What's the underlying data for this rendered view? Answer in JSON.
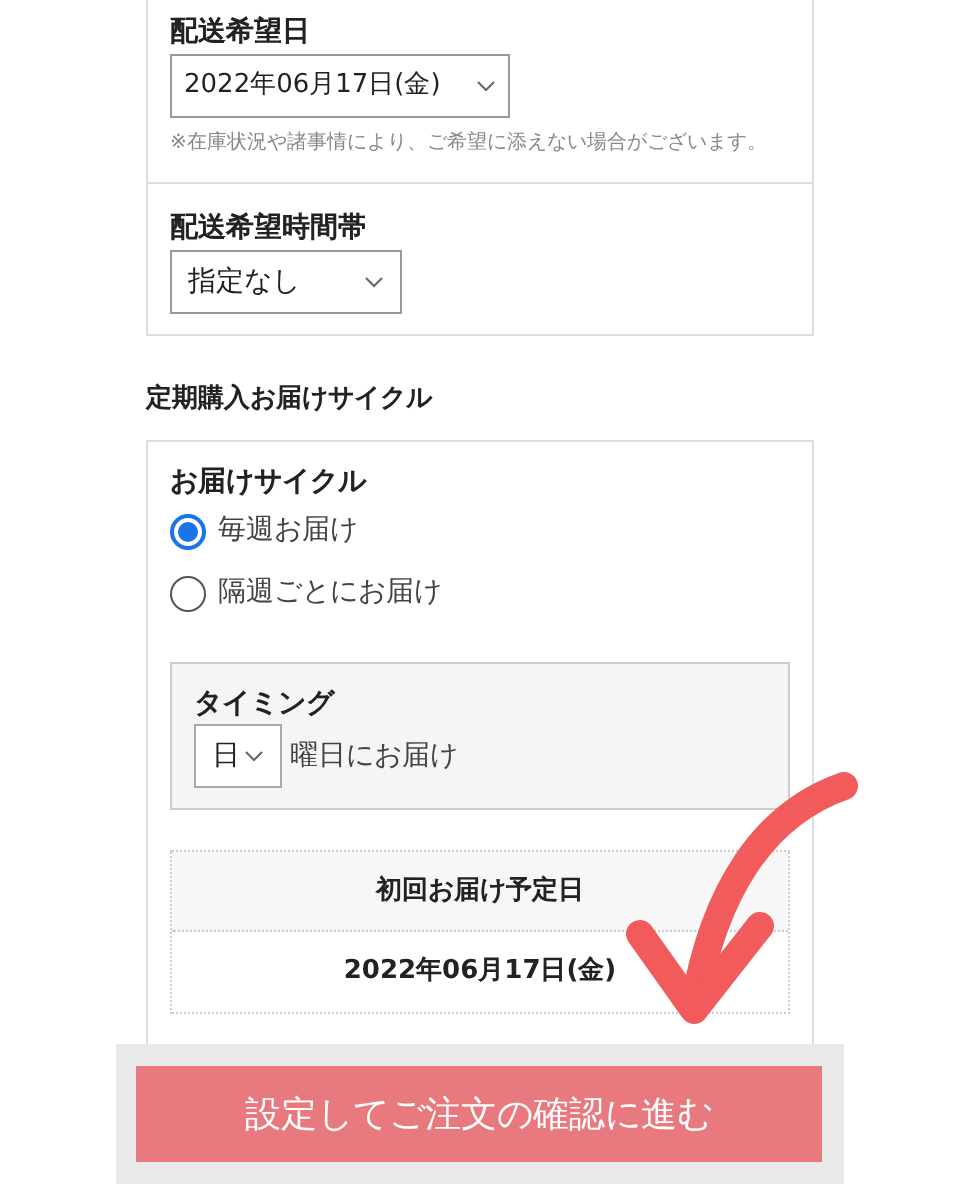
{
  "delivery_date": {
    "label": "配送希望日",
    "value": "2022年06月17日(金)",
    "note": "※在庫状況や諸事情により、ご希望に添えない場合がございます。"
  },
  "time_slot": {
    "label": "配送希望時間帯",
    "value": "指定なし"
  },
  "cycle_section": {
    "title": "定期購入お届けサイクル",
    "label": "お届けサイクル",
    "options": [
      {
        "label": "毎週お届け",
        "selected": true
      },
      {
        "label": "隔週ごとにお届け",
        "selected": false
      }
    ],
    "timing": {
      "label": "タイミング",
      "value": "日",
      "suffix": "曜日にお届け"
    },
    "first_delivery": {
      "header": "初回お届け予定日",
      "value": "2022年06月17日(金)"
    }
  },
  "confirm_button": {
    "label": "設定してご注文の確認に進む"
  }
}
